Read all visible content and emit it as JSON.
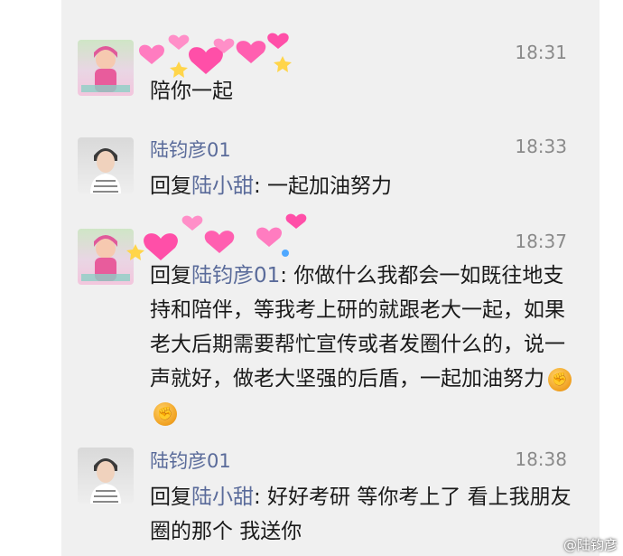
{
  "messages": [
    {
      "sender": "",
      "time": "18:31",
      "text": "陪你一起"
    },
    {
      "sender": "陆钧彦01",
      "time": "18:33",
      "reply_prefix": "回复",
      "reply_to": "陆小甜",
      "text": ": 一起加油努力"
    },
    {
      "sender": "",
      "time": "18:37",
      "reply_prefix": "回复",
      "reply_to": "陆钧彦01",
      "text": ": 你做什么我都会一如既往地支持和陪伴，等我考上研的就跟老大一起，如果老大后期需要帮忙宣传或者发圈什么的，说一声就好，做老大坚强的后盾，一起加油努力",
      "emoji": "fist-emoji"
    },
    {
      "sender": "陆钧彦01",
      "time": "18:38",
      "reply_prefix": "回复",
      "reply_to": "陆小甜",
      "text": ": 好好考研 等你考上了 看上我朋友圈的那个 我送你"
    }
  ],
  "watermark": "@陆钧彦",
  "colors": {
    "panel_bg": "#f0f0f0",
    "name_color": "#5a6b9a",
    "heart_pink": "#ff4fa8"
  }
}
